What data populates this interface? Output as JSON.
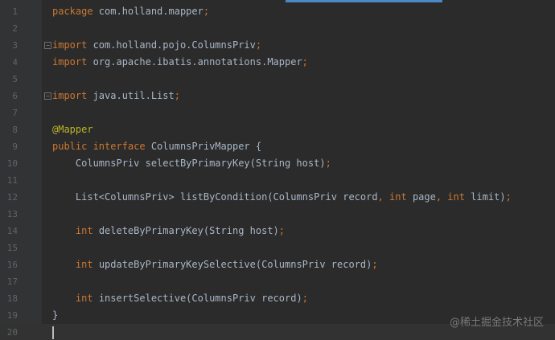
{
  "editor": {
    "lines": [
      {
        "n": "1",
        "tokens": [
          {
            "t": "package ",
            "c": "kw"
          },
          {
            "t": "com.holland.mapper",
            "c": "pkg"
          },
          {
            "t": ";",
            "c": "kw"
          }
        ]
      },
      {
        "n": "2",
        "tokens": []
      },
      {
        "n": "3",
        "fold": true,
        "tokens": [
          {
            "t": "import ",
            "c": "kw"
          },
          {
            "t": "com.holland.pojo.ColumnsPriv",
            "c": "pkg"
          },
          {
            "t": ";",
            "c": "kw"
          }
        ]
      },
      {
        "n": "4",
        "tokens": [
          {
            "t": "import ",
            "c": "kw"
          },
          {
            "t": "org.apache.ibatis.annotations.Mapper",
            "c": "pkg"
          },
          {
            "t": ";",
            "c": "kw"
          }
        ]
      },
      {
        "n": "5",
        "tokens": []
      },
      {
        "n": "6",
        "fold": true,
        "tokens": [
          {
            "t": "import ",
            "c": "kw"
          },
          {
            "t": "java.util.List",
            "c": "pkg"
          },
          {
            "t": ";",
            "c": "kw"
          }
        ]
      },
      {
        "n": "7",
        "tokens": []
      },
      {
        "n": "8",
        "tokens": [
          {
            "t": "@Mapper",
            "c": "ann"
          }
        ]
      },
      {
        "n": "9",
        "tokens": [
          {
            "t": "public interface ",
            "c": "kw"
          },
          {
            "t": "ColumnsPrivMapper {",
            "c": "pkg"
          }
        ]
      },
      {
        "n": "10",
        "tokens": [
          {
            "t": "    ColumnsPriv selectByPrimaryKey(String host)",
            "c": "pkg"
          },
          {
            "t": ";",
            "c": "kw"
          }
        ]
      },
      {
        "n": "11",
        "tokens": []
      },
      {
        "n": "12",
        "tokens": [
          {
            "t": "    List<ColumnsPriv> listByCondition(ColumnsPriv record",
            "c": "pkg"
          },
          {
            "t": ", ",
            "c": "kw"
          },
          {
            "t": "int ",
            "c": "kw"
          },
          {
            "t": "page",
            "c": "pkg"
          },
          {
            "t": ", ",
            "c": "kw"
          },
          {
            "t": "int ",
            "c": "kw"
          },
          {
            "t": "limit)",
            "c": "pkg"
          },
          {
            "t": ";",
            "c": "kw"
          }
        ]
      },
      {
        "n": "13",
        "tokens": []
      },
      {
        "n": "14",
        "tokens": [
          {
            "t": "    ",
            "c": "pkg"
          },
          {
            "t": "int ",
            "c": "kw"
          },
          {
            "t": "deleteByPrimaryKey(String host)",
            "c": "pkg"
          },
          {
            "t": ";",
            "c": "kw"
          }
        ]
      },
      {
        "n": "15",
        "tokens": []
      },
      {
        "n": "16",
        "tokens": [
          {
            "t": "    ",
            "c": "pkg"
          },
          {
            "t": "int ",
            "c": "kw"
          },
          {
            "t": "updateByPrimaryKeySelective(ColumnsPriv record)",
            "c": "pkg"
          },
          {
            "t": ";",
            "c": "kw"
          }
        ]
      },
      {
        "n": "17",
        "tokens": []
      },
      {
        "n": "18",
        "tokens": [
          {
            "t": "    ",
            "c": "pkg"
          },
          {
            "t": "int ",
            "c": "kw"
          },
          {
            "t": "insertSelective(ColumnsPriv record)",
            "c": "pkg"
          },
          {
            "t": ";",
            "c": "kw"
          }
        ]
      },
      {
        "n": "19",
        "tokens": [
          {
            "t": "}",
            "c": "pkg"
          }
        ]
      },
      {
        "n": "20",
        "current": true,
        "caret": true,
        "tokens": []
      }
    ]
  },
  "watermark": "@稀土掘金技术社区",
  "colors": {
    "background": "#2b2b2b",
    "keyword": "#cc7832",
    "annotation": "#bbb529",
    "text": "#a9b7c6",
    "accent": "#4a88c7"
  }
}
